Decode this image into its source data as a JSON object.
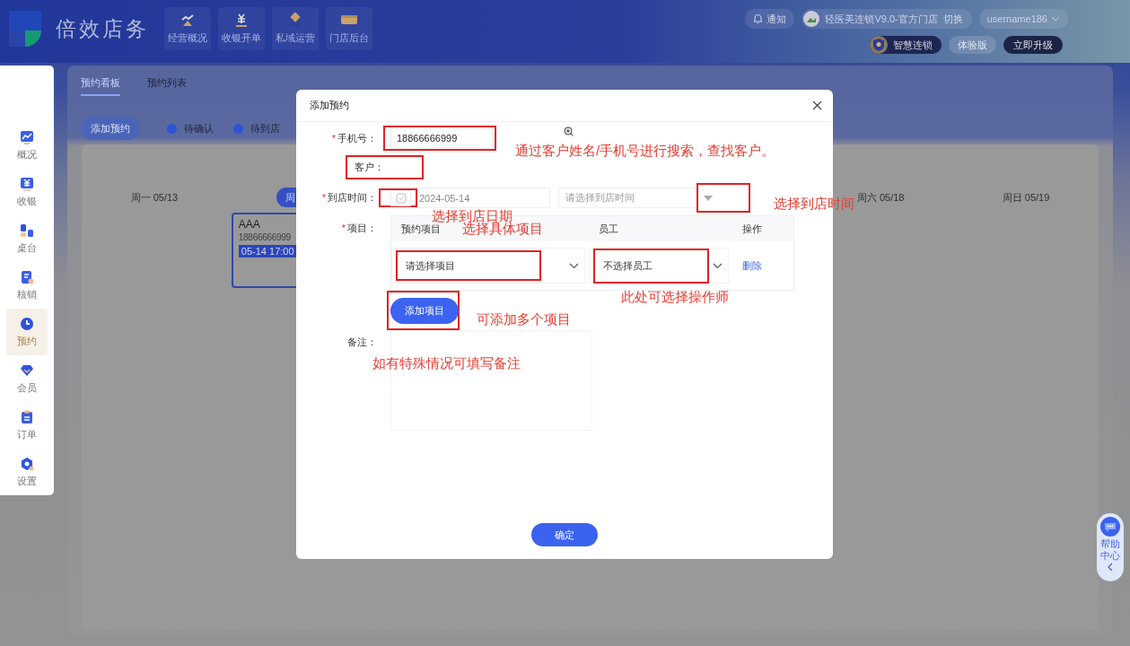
{
  "header": {
    "logo_title": "倍效店务",
    "nav": [
      {
        "label": "经营概况"
      },
      {
        "label": "收银开单"
      },
      {
        "label": "私域运营"
      },
      {
        "label": "门店后台"
      }
    ],
    "notice": "通知",
    "store": "轻医美连锁V9.0-官方门店",
    "switch": "切换",
    "user": "username186",
    "plan": "智慧连锁",
    "trial": "体验版",
    "upgrade": "立即升级"
  },
  "sidebar": {
    "items": [
      {
        "label": "概况",
        "selected": false
      },
      {
        "label": "收银",
        "selected": false
      },
      {
        "label": "桌台",
        "selected": false
      },
      {
        "label": "核销",
        "selected": false
      },
      {
        "label": "预约",
        "selected": true
      },
      {
        "label": "会员",
        "selected": false
      },
      {
        "label": "订单",
        "selected": false
      },
      {
        "label": "设置",
        "selected": false
      }
    ]
  },
  "board": {
    "tabs": [
      {
        "label": "预约看板",
        "selected": true
      },
      {
        "label": "预约列表",
        "selected": false
      }
    ],
    "add_button": "添加预约",
    "legend": [
      {
        "label": "待确认",
        "color": "#2c54d4"
      },
      {
        "label": "待到店",
        "color": "#2c54d4"
      }
    ],
    "days": [
      {
        "label": "周一 05/13",
        "selected": false
      },
      {
        "label": "周",
        "selected": true
      },
      {
        "label": "周六 05/18",
        "selected": false
      },
      {
        "label": "周日 05/19",
        "selected": false
      }
    ],
    "appointment": {
      "name": "AAA",
      "phone": "18866666999",
      "time": "05-14 17:00"
    }
  },
  "dialog": {
    "title": "添加预约",
    "phone": {
      "mark": "*",
      "label": "手机号：",
      "value": "18866666999"
    },
    "customer": {
      "label": "客户："
    },
    "arrival": {
      "mark": "*",
      "label": "到店时间：",
      "date": "2024-05-14",
      "time_placeholder": "请选择到店时间"
    },
    "items": {
      "mark": "*",
      "label": "项目：",
      "columns": [
        "预约项目",
        "员工",
        "操作"
      ],
      "rows": [
        {
          "project": "请选择项目",
          "staff": "不选择员工",
          "action": "删除"
        }
      ],
      "add_button": "添加项目"
    },
    "remark": {
      "label": "备注："
    },
    "confirm": "确定"
  },
  "annotations": [
    {
      "text": "通过客户姓名/手机号进行搜索，查找客户。"
    },
    {
      "text": "选择到店日期"
    },
    {
      "text": "选择到店时间"
    },
    {
      "text": "选择具体项目"
    },
    {
      "text": "此处可选择操作师"
    },
    {
      "text": "可添加多个项目"
    },
    {
      "text": "如有特殊情况可填写备注"
    }
  ],
  "help": {
    "label": "帮助中心"
  }
}
